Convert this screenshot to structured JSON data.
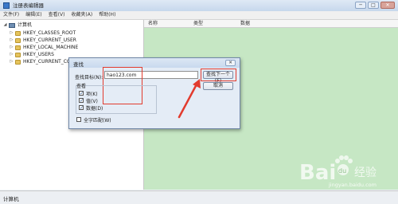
{
  "window": {
    "title": "注册表编辑器",
    "controls": [
      "─",
      "□",
      "✕"
    ]
  },
  "menu": [
    "文件(F)",
    "编辑(E)",
    "查看(V)",
    "收藏夹(A)",
    "帮助(H)"
  ],
  "tree": {
    "root": "计算机",
    "items": [
      "HKEY_CLASSES_ROOT",
      "HKEY_CURRENT_USER",
      "HKEY_LOCAL_MACHINE",
      "HKEY_USERS",
      "HKEY_CURRENT_CO"
    ]
  },
  "list": {
    "columns": [
      "名称",
      "类型",
      "数据"
    ]
  },
  "status": {
    "text": "计算机"
  },
  "find_dialog": {
    "title": "查找",
    "find_label": "查找目标(N):",
    "find_value": "hao123.com",
    "find_next_label": "查找下一个(F)",
    "cancel_label": "取消",
    "look_at_label": "查看",
    "options": [
      {
        "label": "项(K)",
        "checked": true
      },
      {
        "label": "值(V)",
        "checked": true
      },
      {
        "label": "数据(D)",
        "checked": true
      }
    ],
    "match_whole_label": "全字匹配(W)",
    "match_whole_checked": false
  },
  "watermark": {
    "brand": "Bai",
    "paw": "du",
    "suffix": "经验",
    "url": "jingyan.baidu.com"
  },
  "colors": {
    "highlight": "#e23b2e",
    "list_bg": "#c6e7c4"
  }
}
